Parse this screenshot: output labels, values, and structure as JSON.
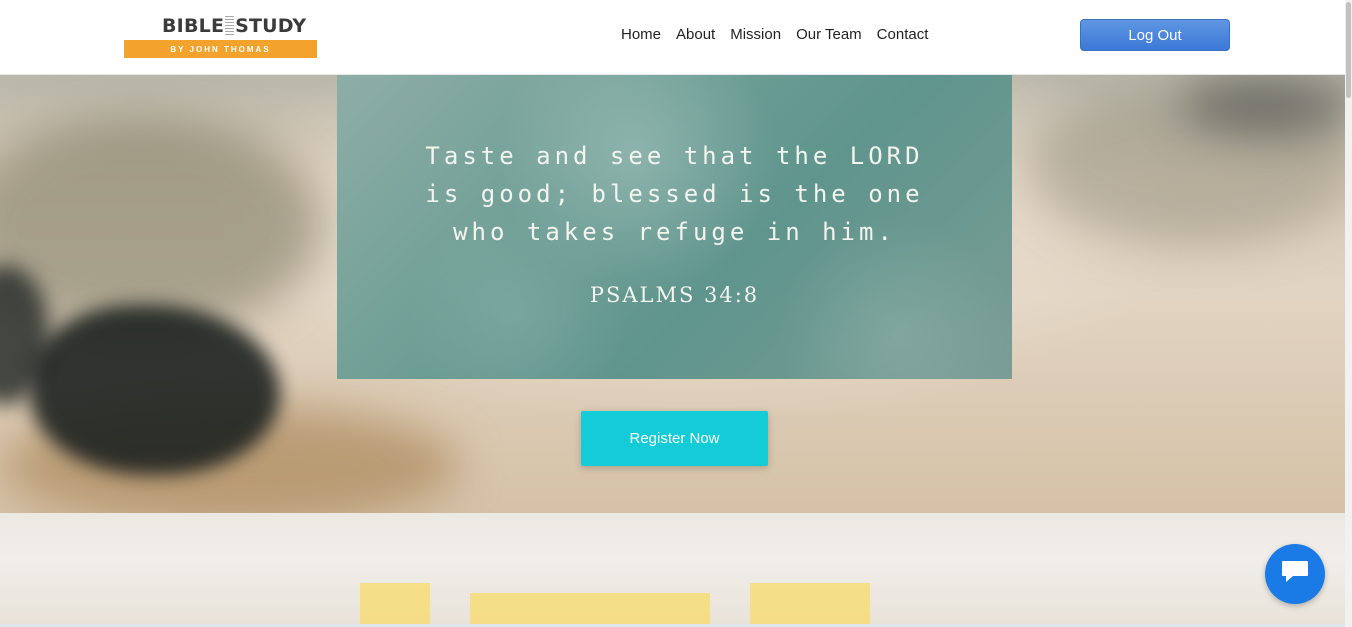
{
  "header": {
    "logo": {
      "title_left": "BIBLE",
      "title_right": "STUDY",
      "subtitle": "BY JOHN THOMAS"
    },
    "nav": [
      {
        "label": "Home"
      },
      {
        "label": "About"
      },
      {
        "label": "Mission"
      },
      {
        "label": "Our Team"
      },
      {
        "label": "Contact"
      }
    ],
    "logout_label": "Log Out"
  },
  "hero": {
    "verse": "Taste and see that the LORD\nis good; blessed is the one\nwho takes refuge in him.",
    "reference": "PSALMS 34:8",
    "register_label": "Register Now"
  },
  "colors": {
    "accent_cyan": "#13ccd8",
    "logout_blue": "#4a86dd",
    "logo_orange": "#f3a22c",
    "chat_blue": "#1a7be7"
  },
  "icons": {
    "chat": "chat-bubble-icon"
  }
}
